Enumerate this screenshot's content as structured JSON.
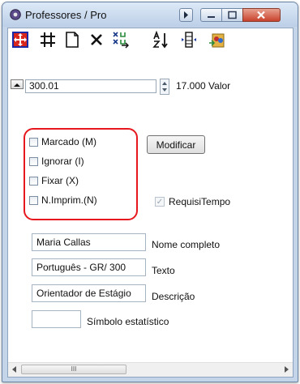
{
  "window": {
    "title": "Professores / Pro"
  },
  "toolbar": {
    "icons": [
      "grid-target-icon",
      "hash-grid-icon",
      "new-document-icon",
      "delete-x-icon",
      "swap-columns-icon",
      "sort-az-icon",
      "column-insert-icon",
      "export-people-icon"
    ]
  },
  "record": {
    "id_value": "300.01",
    "valor_label": "17.000 Valor"
  },
  "flags": {
    "marcado": "Marcado (M)",
    "ignorar": "Ignorar (I)",
    "fixar": "Fixar (X)",
    "nimprim": "N.Imprim.(N)"
  },
  "buttons": {
    "modificar": "Modificar"
  },
  "requisi": {
    "label": "RequisiTempo",
    "checked": true
  },
  "fields": {
    "nome": {
      "value": "Maria Callas",
      "label": "Nome completo"
    },
    "texto": {
      "value": "Português - GR/ 300",
      "label": "Texto"
    },
    "descricao": {
      "value": "Orientador de Estágio",
      "label": "Descrição"
    },
    "simbolo": {
      "value": "",
      "label": "Símbolo estatístico"
    }
  },
  "scrollbar": {
    "thumb_grip": "III"
  },
  "colors": {
    "highlight_border": "#e6171d",
    "close_button": "#c8422c",
    "title_bar": "#c4d5ea"
  }
}
